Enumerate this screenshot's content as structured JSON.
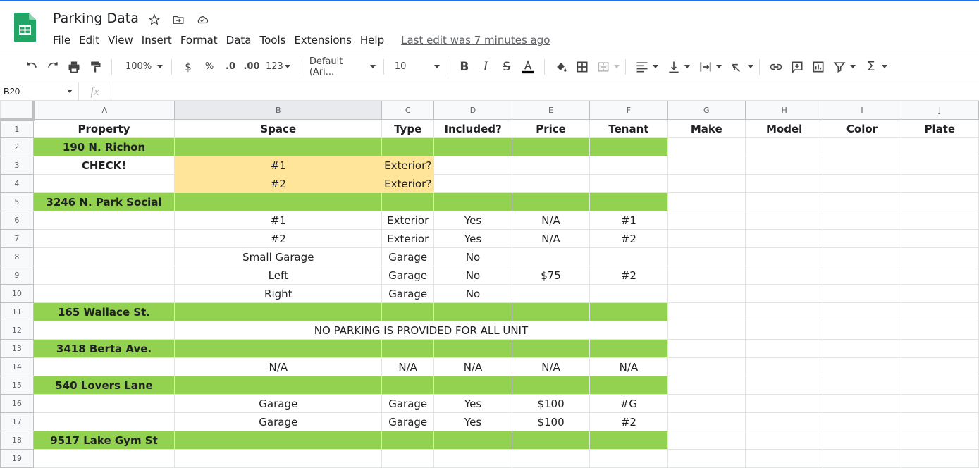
{
  "app": {
    "doc_title": "Parking Data",
    "menus": [
      "File",
      "Edit",
      "View",
      "Insert",
      "Format",
      "Data",
      "Tools",
      "Extensions",
      "Help"
    ],
    "last_edit": "Last edit was 7 minutes ago"
  },
  "toolbar": {
    "zoom": "100%",
    "currency": "$",
    "percent": "%",
    "dec_decrease": ".0",
    "dec_increase": ".00",
    "more_formats": "123",
    "font": "Default (Ari...",
    "font_size": "10"
  },
  "formula_bar": {
    "name_box": "B20",
    "fx": "fx",
    "value": ""
  },
  "colors": {
    "section_green": "#93d150",
    "highlight_yellow": "#ffe599",
    "brand_green": "#23a566"
  },
  "sheet": {
    "columns": [
      "A",
      "B",
      "C",
      "D",
      "E",
      "F",
      "G",
      "H",
      "I",
      "J"
    ],
    "headers": [
      "Property",
      "Space",
      "Type",
      "Included?",
      "Price",
      "Tenant",
      "Make",
      "Model",
      "Color",
      "Plate"
    ],
    "rows": [
      {
        "n": "2",
        "property": "190 N. Richon"
      },
      {
        "n": "3",
        "property": "CHECK!",
        "space": "#1",
        "type": "Exterior?"
      },
      {
        "n": "4",
        "space": "#2",
        "type": "Exterior?"
      },
      {
        "n": "5",
        "property": "3246 N. Park Social"
      },
      {
        "n": "6",
        "space": "#1",
        "type": "Exterior",
        "included": "Yes",
        "price": "N/A",
        "tenant": "#1"
      },
      {
        "n": "7",
        "space": "#2",
        "type": "Exterior",
        "included": "Yes",
        "price": "N/A",
        "tenant": "#2"
      },
      {
        "n": "8",
        "space": "Small Garage",
        "type": "Garage",
        "included": "No"
      },
      {
        "n": "9",
        "space": "Left",
        "type": "Garage",
        "included": "No",
        "price": "$75",
        "tenant": "#2"
      },
      {
        "n": "10",
        "space": "Right",
        "type": "Garage",
        "included": "No"
      },
      {
        "n": "11",
        "property": "165 Wallace St."
      },
      {
        "n": "12",
        "note": "NO PARKING IS PROVIDED FOR ALL UNIT"
      },
      {
        "n": "13",
        "property": "3418 Berta Ave."
      },
      {
        "n": "14",
        "space": "N/A",
        "type": "N/A",
        "included": "N/A",
        "price": "N/A",
        "tenant": "N/A"
      },
      {
        "n": "15",
        "property": "540 Lovers Lane"
      },
      {
        "n": "16",
        "space": "Garage",
        "type": "Garage",
        "included": "Yes",
        "price": "$100",
        "tenant": "#G"
      },
      {
        "n": "17",
        "space": "Garage",
        "type": "Garage",
        "included": "Yes",
        "price": "$100",
        "tenant": "#2"
      },
      {
        "n": "18",
        "property": "9517 Lake Gym St"
      },
      {
        "n": "19"
      }
    ]
  }
}
